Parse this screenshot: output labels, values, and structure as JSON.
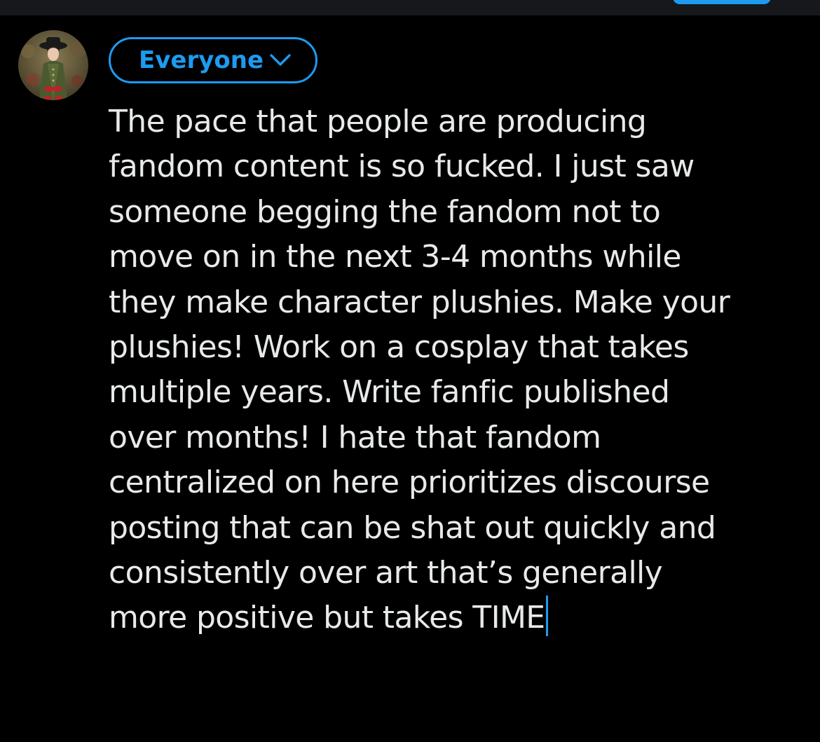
{
  "audience": {
    "label": "Everyone",
    "chevron_icon": "chevron-down-icon",
    "color": "#1d9bf0"
  },
  "avatar": {
    "icon": "user-avatar-photo"
  },
  "compose": {
    "text": "The pace that people are producing\nfandom content is so fucked. I just saw\nsomeone begging the fandom not to\nmove on in the next 3-4 months while\nthey make character plushies. Make your\nplushies! Work on a cosplay that takes\nmultiple years. Write fanfic published\nover months! I hate that fandom\ncentralized on here prioritizes discourse\nposting that can be shat out quickly and\nconsistently over art that’s generally\nmore positive but takes TIME",
    "text_color": "#e7e9ea",
    "caret_color": "#1d9bf0"
  },
  "theme": {
    "background": "#000000",
    "header_background": "#16181c",
    "accent": "#1d9bf0"
  }
}
